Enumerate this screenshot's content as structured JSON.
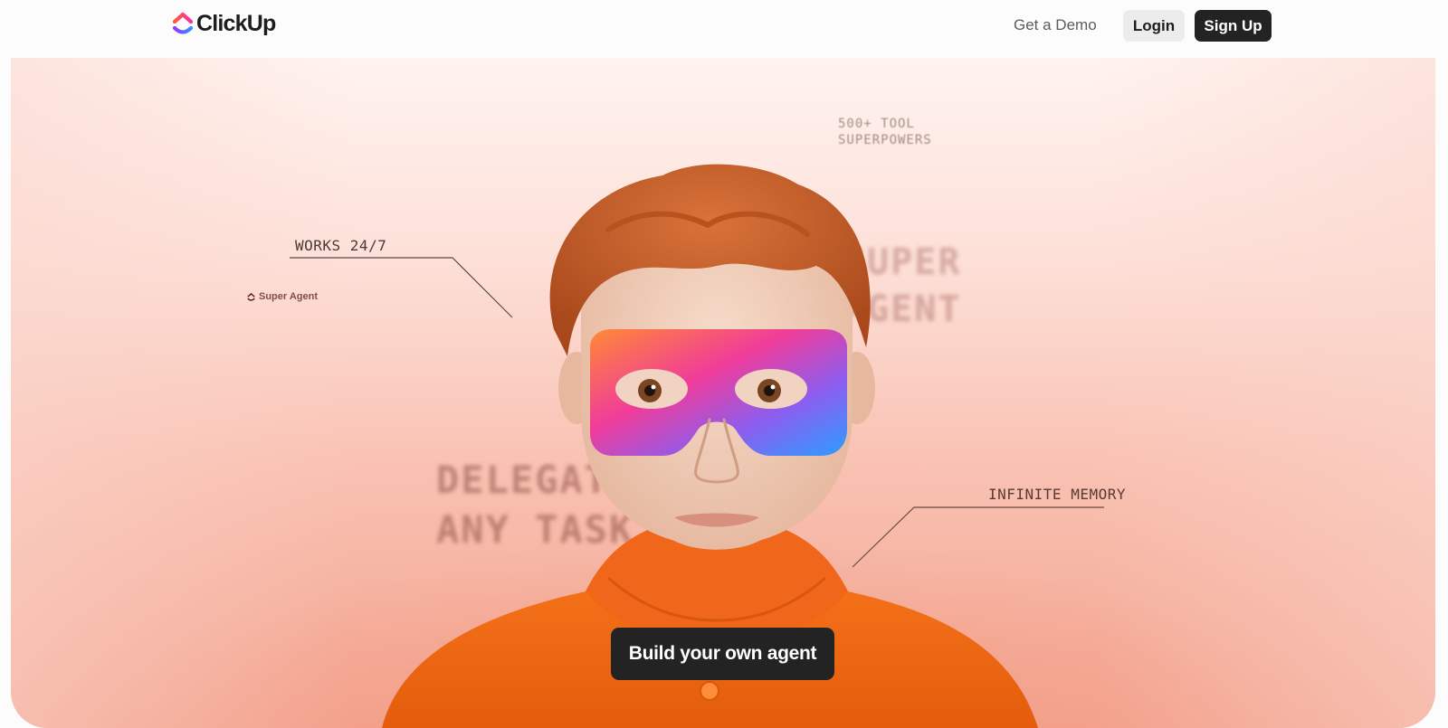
{
  "header": {
    "logo_text": "ClickUp",
    "nav": {
      "demo_label": "Get a Demo",
      "login_label": "Login",
      "signup_label": "Sign Up"
    }
  },
  "hero": {
    "callouts": {
      "works": "WORKS 24/7",
      "tools": "500+ TOOL\nSUPERPOWERS",
      "memory": "INFINITE MEMORY",
      "super_agent": "SUPER\nAGENT",
      "delegate": "DELEGATE\nANY TASK"
    },
    "mask_brand": "Super Agent",
    "cta_label": "Build your own agent"
  },
  "colors": {
    "brand_dark": "#232323",
    "hero_bg_top": "#fff3f0",
    "hero_bg_bottom": "#f3a48f",
    "sweater": "#f36a12",
    "hair": "#c05a24",
    "mask_gradient": [
      "#ff7a2f",
      "#ee3a9f",
      "#7a5cf0",
      "#2f9bff"
    ]
  },
  "icons": {
    "logo": "clickup-logo-icon"
  }
}
